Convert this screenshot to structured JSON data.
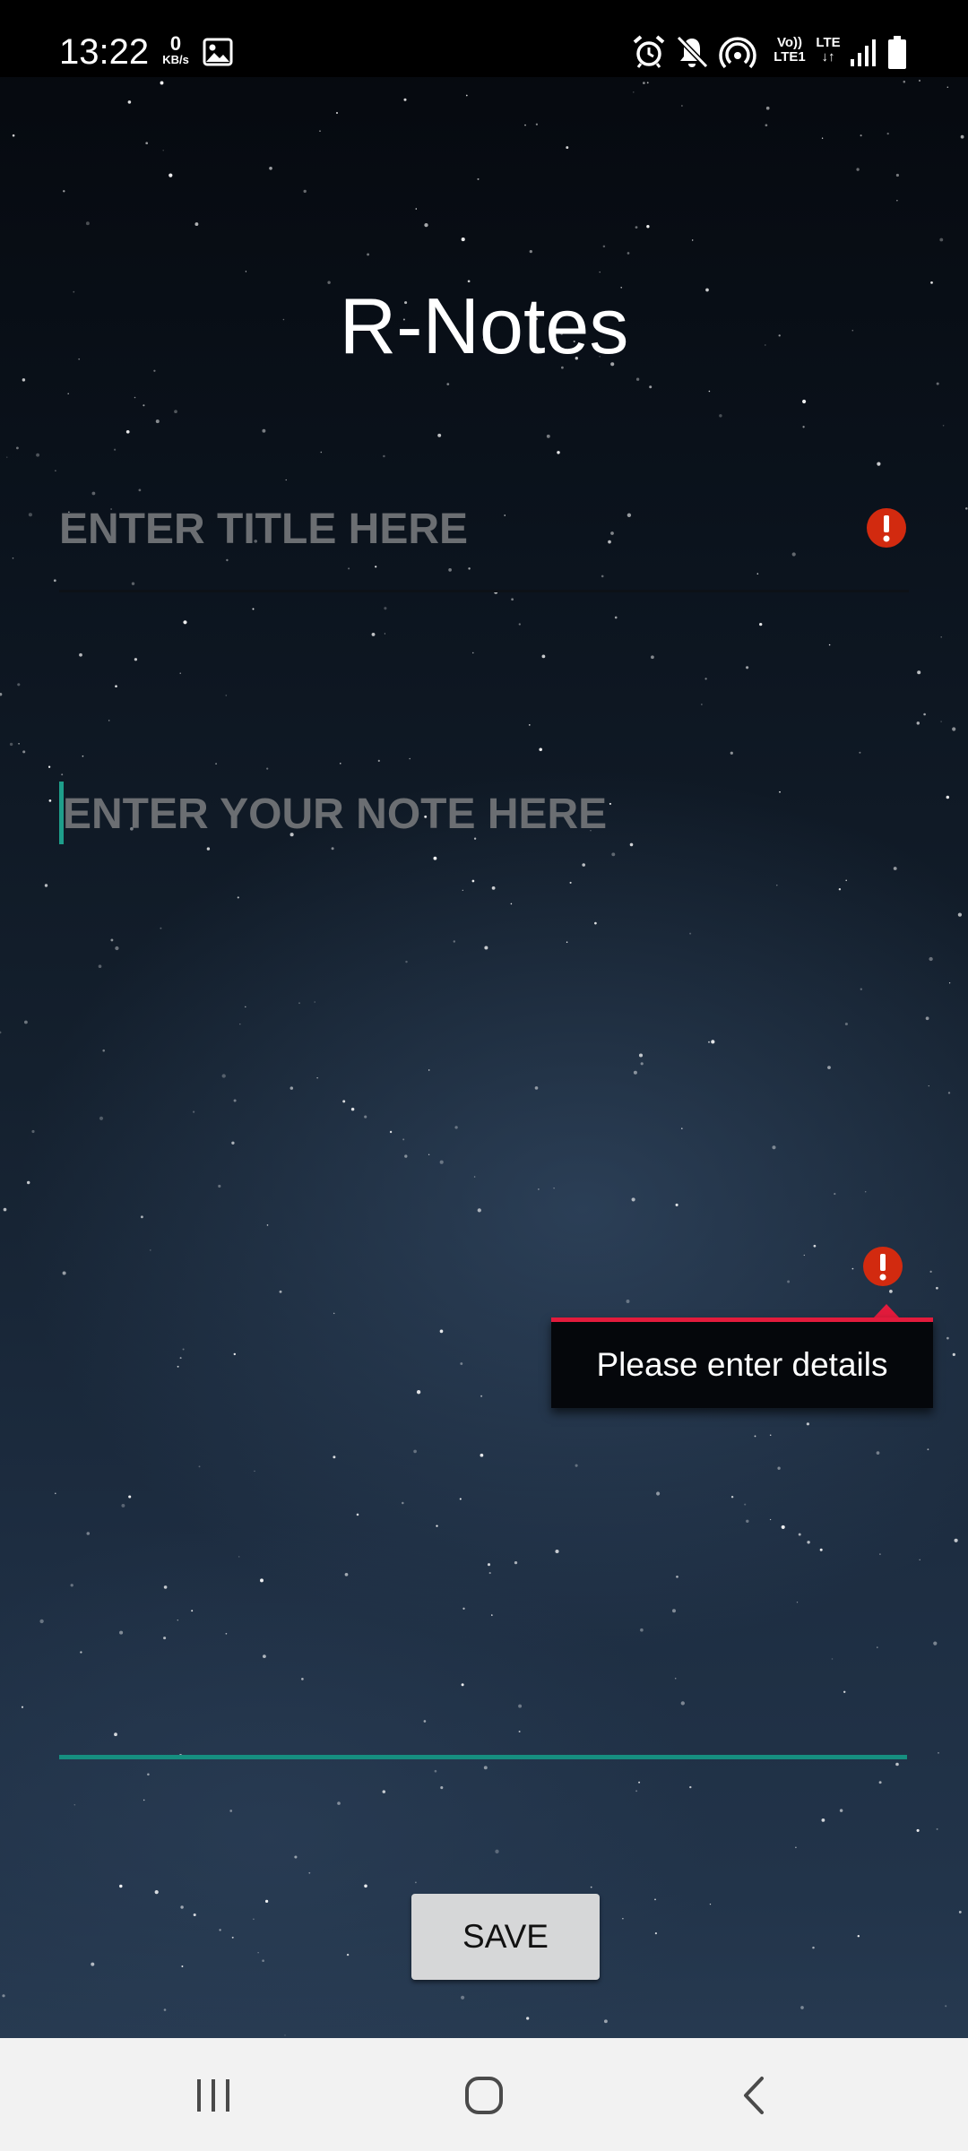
{
  "status_bar": {
    "time": "13:22",
    "net_speed_value": "0",
    "net_speed_unit": "KB/s",
    "lte_volte_label": "Vo))",
    "lte1_label": "LTE1",
    "lte_label": "LTE",
    "icons": [
      "image-icon",
      "alarm-icon",
      "mute-icon",
      "hotspot-icon",
      "volte-icon",
      "lte-data-icon",
      "signal-icon",
      "battery-icon"
    ]
  },
  "app": {
    "title": "R-Notes"
  },
  "form": {
    "title_placeholder": "ENTER TITLE HERE",
    "title_value": "",
    "note_placeholder": "ENTER YOUR NOTE HERE",
    "note_value": "",
    "error_message": "Please enter details",
    "save_label": "SAVE"
  },
  "colors": {
    "accent": "#168f80",
    "error": "#e21b3c",
    "error_icon": "#d22a0f"
  },
  "nav_bar": {
    "buttons": [
      "recents-icon",
      "home-icon",
      "back-icon"
    ]
  }
}
